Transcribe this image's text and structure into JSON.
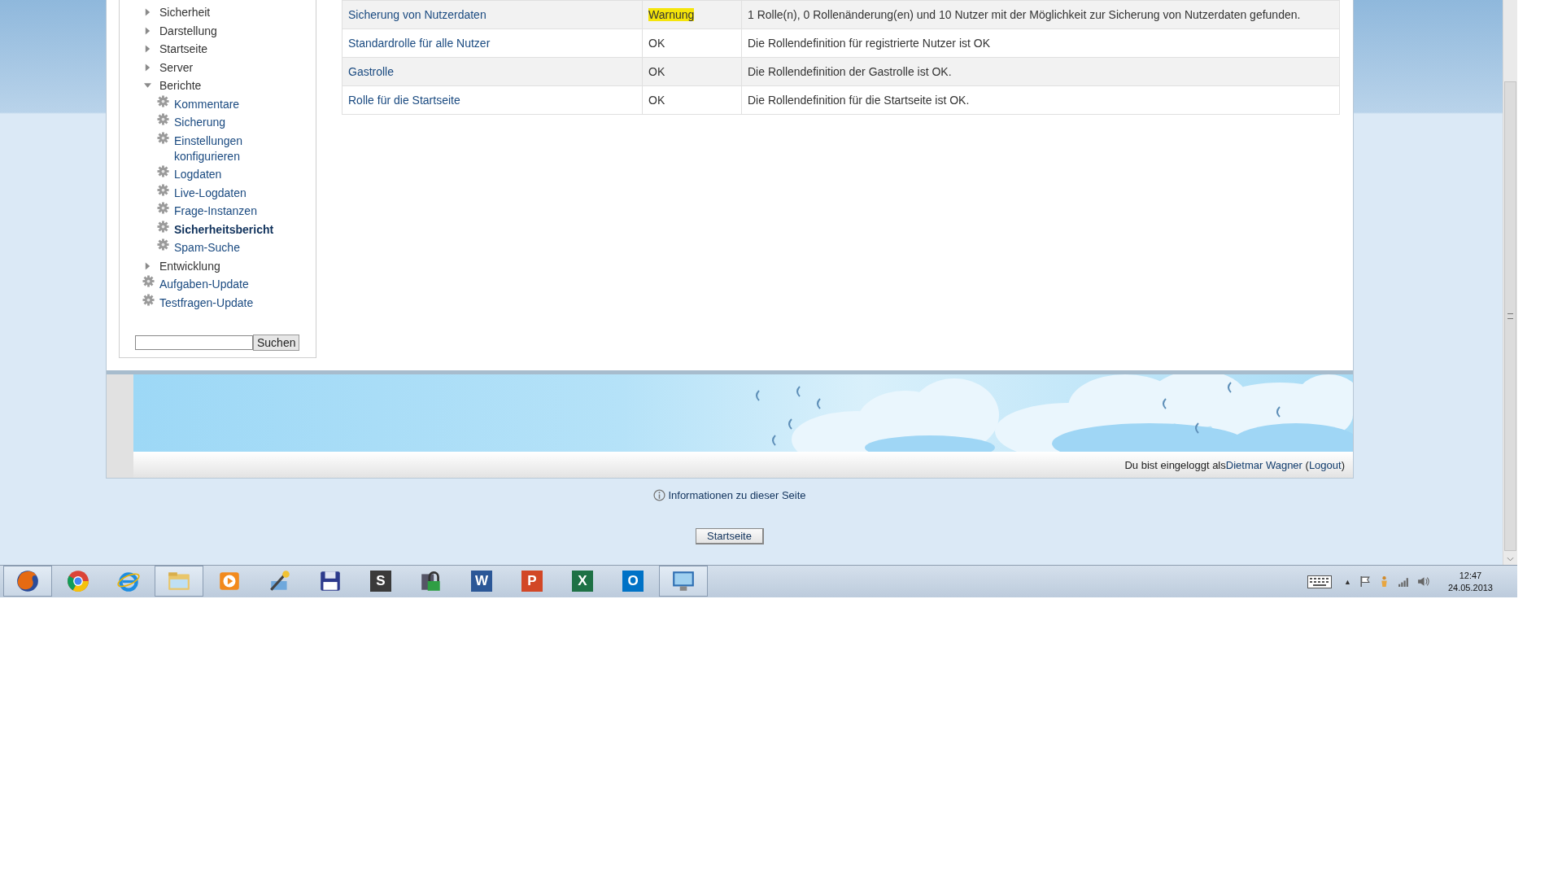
{
  "sidebar": {
    "items": [
      {
        "kind": "folder",
        "label": "Sicherheit",
        "expanded": false
      },
      {
        "kind": "folder",
        "label": "Darstellung",
        "expanded": false
      },
      {
        "kind": "folder",
        "label": "Startseite",
        "expanded": false
      },
      {
        "kind": "folder",
        "label": "Server",
        "expanded": false
      },
      {
        "kind": "folder",
        "label": "Berichte",
        "expanded": true,
        "children": [
          {
            "kind": "page",
            "label": "Kommentare",
            "selected": false
          },
          {
            "kind": "page",
            "label": "Sicherung",
            "selected": false
          },
          {
            "kind": "page",
            "label": "Einstellungen konfigurieren",
            "selected": false
          },
          {
            "kind": "page",
            "label": "Logdaten",
            "selected": false
          },
          {
            "kind": "page",
            "label": "Live-Logdaten",
            "selected": false
          },
          {
            "kind": "page",
            "label": "Frage-Instanzen",
            "selected": false
          },
          {
            "kind": "page",
            "label": "Sicherheitsbericht",
            "selected": true
          },
          {
            "kind": "page",
            "label": "Spam-Suche",
            "selected": false
          }
        ]
      },
      {
        "kind": "folder",
        "label": "Entwicklung",
        "expanded": false
      },
      {
        "kind": "page",
        "label": "Aufgaben-Update",
        "selected": false
      },
      {
        "kind": "page",
        "label": "Testfragen-Update",
        "selected": false
      }
    ],
    "search_button": "Suchen"
  },
  "table": {
    "rows": [
      {
        "issue": "Sicherung von Nutzerdaten",
        "status": "Warnung",
        "highlighted": true,
        "description": "1 Rolle(n), 0 Rollenänderung(en) und 10 Nutzer mit der Möglichkeit zur Sicherung von Nutzerdaten gefunden."
      },
      {
        "issue": "Standardrolle für alle Nutzer",
        "status": "OK",
        "highlighted": false,
        "description": "Die Rollendefinition für registrierte Nutzer ist OK"
      },
      {
        "issue": "Gastrolle",
        "status": "OK",
        "highlighted": false,
        "description": "Die Rollendefinition der Gastrolle ist OK."
      },
      {
        "issue": "Rolle für die Startseite",
        "status": "OK",
        "highlighted": false,
        "description": "Die Rollendefinition für die Startseite ist OK."
      }
    ]
  },
  "footer": {
    "login_text": "Du bist eingeloggt als",
    "user": "Dietmar Wagner",
    "open_paren": "(",
    "logout": "Logout",
    "close_paren": ")"
  },
  "info_link": "Informationen zu dieser Seite",
  "home_button": "Startseite",
  "taskbar": {
    "apps": [
      {
        "kind": "globe",
        "running": true
      },
      {
        "kind": "ring",
        "running": false
      },
      {
        "kind": "e",
        "running": false
      },
      {
        "kind": "folder",
        "running": true
      },
      {
        "kind": "play",
        "running": false
      },
      {
        "kind": "tools",
        "running": false
      },
      {
        "kind": "floppy",
        "running": false
      },
      {
        "kind": "tile",
        "letter": "S",
        "color": "#3a3a3a",
        "running": false
      },
      {
        "kind": "lock",
        "running": false
      },
      {
        "kind": "tile",
        "letter": "W",
        "color": "#2b5797",
        "running": false
      },
      {
        "kind": "tile",
        "letter": "P",
        "color": "#d24726",
        "running": false
      },
      {
        "kind": "tile",
        "letter": "X",
        "color": "#1e7145",
        "running": false
      },
      {
        "kind": "tile",
        "letter": "O",
        "color": "#0072c6",
        "running": false
      },
      {
        "kind": "monitor",
        "running": true
      }
    ],
    "tray_expand": "▲",
    "time": "12:47",
    "date": "24.05.2013"
  }
}
